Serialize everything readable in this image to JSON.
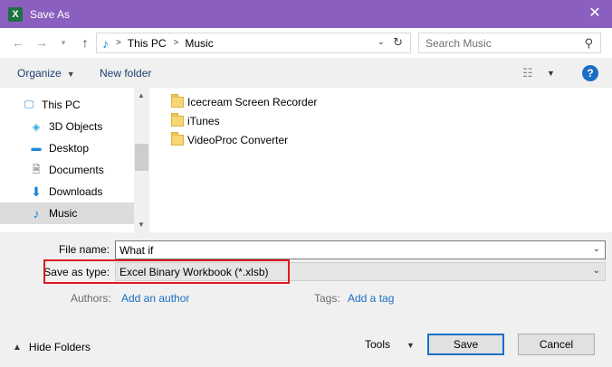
{
  "window": {
    "title": "Save As",
    "app_icon": "X"
  },
  "address": {
    "crumbs": [
      "This PC",
      "Music"
    ]
  },
  "search": {
    "placeholder": "Search Music"
  },
  "toolbar": {
    "organize": "Organize",
    "new_folder": "New folder",
    "help": "?"
  },
  "nav": {
    "items": [
      {
        "label": "This PC",
        "icon": "computer-icon"
      },
      {
        "label": "3D Objects",
        "icon": "cube-icon"
      },
      {
        "label": "Desktop",
        "icon": "desktop-icon"
      },
      {
        "label": "Documents",
        "icon": "document-icon"
      },
      {
        "label": "Downloads",
        "icon": "download-icon"
      },
      {
        "label": "Music",
        "icon": "music-icon",
        "selected": true
      }
    ]
  },
  "files": [
    {
      "name": "Icecream Screen Recorder"
    },
    {
      "name": "iTunes"
    },
    {
      "name": "VideoProc Converter"
    }
  ],
  "form": {
    "file_name_label": "File name:",
    "file_name_value": "What if",
    "save_type_label": "Save as type:",
    "save_type_value": "Excel Binary Workbook (*.xlsb)",
    "authors_label": "Authors:",
    "authors_link": "Add an author",
    "tags_label": "Tags:",
    "tags_link": "Add a tag"
  },
  "footer": {
    "hide_folders": "Hide Folders",
    "tools": "Tools",
    "save": "Save",
    "cancel": "Cancel"
  },
  "colors": {
    "titlebar": "#8b5fbf",
    "accent": "#1a6fc4",
    "highlight": "#e0191f"
  }
}
